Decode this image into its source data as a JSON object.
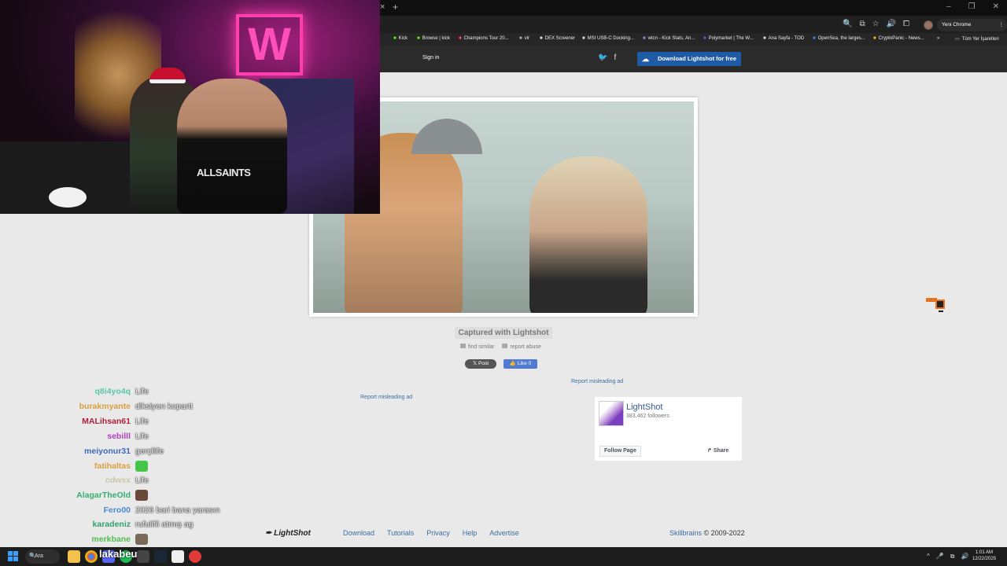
{
  "browser": {
    "tab_close": "×",
    "tab_new": "+",
    "window_controls": [
      "–",
      "❐",
      "✕"
    ],
    "toolbar_icons": [
      "🔍",
      "⧉",
      "☆",
      "🔊",
      "⧠"
    ],
    "chrome_pill": "Yeni Chrome kullanılabilir",
    "chrome_pill_dots": "⋮",
    "bookmarks": [
      "Kick",
      "Browse | kick",
      "Champions Tour 20...",
      "vlr",
      "DEX Screener",
      "MSI USB-C Docking...",
      "wtcn - Kick Stats, An...",
      "Polymarket | The W...",
      "Ana Sayfa - TOD",
      "OpenSea, the larges...",
      "CryptoPanic - News..."
    ],
    "bookmarks_more": "»",
    "all_bookmarks": "Tüm Yer İşaretleri"
  },
  "lightshot": {
    "signin": "Sign in",
    "twitter_icon": "🐦",
    "facebook_icon": "f",
    "download_button": "Download Lightshot for free",
    "captured": "Captured with Lightshot",
    "find_similar": "find similar",
    "report_abuse": "report abuse",
    "post": "𝕏 Post",
    "like": "👍 Like 0",
    "report_ad_left": "Report misleading ad",
    "report_ad_right": "Report misleading ad",
    "fb": {
      "name": "LightShot",
      "followers": "383,462 followers",
      "follow": "Follow Page",
      "share": "Share"
    },
    "footer": {
      "logo": "LightShot",
      "nav": [
        "Download",
        "Tutorials",
        "Privacy",
        "Help",
        "Advertise"
      ],
      "brand": "Skillbrains",
      "copyright": " © 2009-2022"
    }
  },
  "webcam": {
    "neon_letter": "W",
    "shirt_text": "ALLSAINTS"
  },
  "chat": [
    {
      "user": "q8i4yo4q",
      "msg": "Life",
      "color": "#58c8a8"
    },
    {
      "user": "burakmyante",
      "msg": "diksiyon kopartt",
      "color": "#d8a040"
    },
    {
      "user": "MALihsan61",
      "msg": "Life",
      "color": "#b0203a"
    },
    {
      "user": "sebilll",
      "msg": "Life",
      "color": "#b040c0"
    },
    {
      "user": "meiyonur31",
      "msg": "gerçllife",
      "color": "#3a6ac0"
    },
    {
      "user": "fatihaltas",
      "msg": "",
      "color": "#d8a040",
      "emote": "#45c44a"
    },
    {
      "user": "cdwsx",
      "msg": "Life",
      "color": "#c8c8a0"
    },
    {
      "user": "AlagarTheOld",
      "msg": "",
      "color": "#30b070",
      "emote": "#6a4a3a"
    },
    {
      "user": "Fero00",
      "msg": "2026 bari bana yarasın",
      "color": "#4a8ad0"
    },
    {
      "user": "karadeniz",
      "msg": "rufuiifii atmış ag",
      "color": "#30a070"
    },
    {
      "user": "merkbane",
      "msg": "",
      "color": "#50c050",
      "emote": "#7a6a5a"
    }
  ],
  "taskbar": {
    "search": "Ara",
    "search_icon": "🔍",
    "overlay_name": "lakabeu",
    "tray_icons": [
      "^",
      "🎤",
      "⧉",
      "🔊"
    ],
    "time": "1:01 AM",
    "date": "12/22/2025"
  }
}
